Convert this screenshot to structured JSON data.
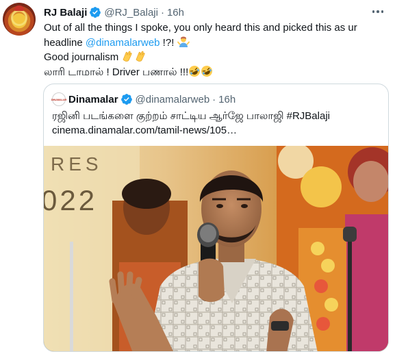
{
  "tweet": {
    "display_name": "RJ Balaji",
    "handle": "@RJ_Balaji",
    "separator": "·",
    "time": "16h",
    "body": {
      "line1": "Out of all the things I spoke, you only heard this and picked this as ur",
      "line2_prefix": "headline ",
      "line2_mention": "@dinamalarweb",
      "line2_suffix": " !?! ",
      "line3": "Good journalism ",
      "line4": "லாரி டாமால் ! Driver பணால் !!!"
    }
  },
  "quoted_tweet": {
    "display_name": "Dinamalar",
    "handle": "@dinamalarweb",
    "separator": "·",
    "time": "16h",
    "avatar_text": "DINAMALAR",
    "text_line1": "ரஜினி படங்களை குற்றம் சாட்டிய ஆர்ஜே பாலாஜி #RJBalaji",
    "text_line2": "cinema.dinamalar.com/tamil-news/105…",
    "media_backdrop_text_1": "RES",
    "media_backdrop_text_2": "022"
  },
  "icons": {
    "verified": "verified-badge-icon",
    "more": "more-options-icon",
    "person_shrugging": "person-shrugging-emoji",
    "clapping": "clapping-hands-emoji",
    "laughing": "rolling-on-floor-laughing-emoji"
  },
  "colors": {
    "link": "#1d9bf0",
    "secondary_text": "#536471",
    "border": "#cfd9de"
  }
}
